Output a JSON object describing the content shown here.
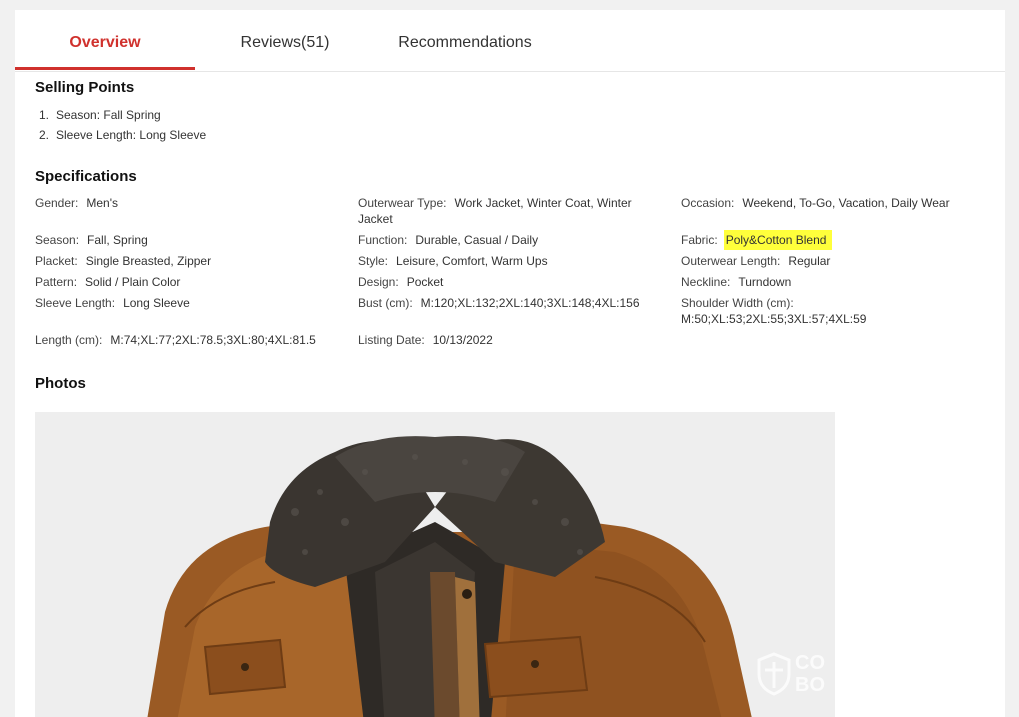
{
  "tabs": [
    {
      "label": "Overview",
      "active": true
    },
    {
      "label": "Reviews(51)",
      "active": false
    },
    {
      "label": "Recommendations",
      "active": false
    }
  ],
  "selling_points": {
    "title": "Selling Points",
    "items": [
      {
        "num": "1.",
        "text": "Season: Fall Spring"
      },
      {
        "num": "2.",
        "text": "Sleeve Length: Long Sleeve"
      }
    ]
  },
  "specifications": {
    "title": "Specifications",
    "items": [
      {
        "key": "Gender:",
        "value": "Men's"
      },
      {
        "key": "Outerwear Type:",
        "value": "Work Jacket, Winter Coat, Winter Jacket"
      },
      {
        "key": "Occasion:",
        "value": "Weekend, To-Go, Vacation, Daily Wear"
      },
      {
        "key": "Season:",
        "value": "Fall, Spring"
      },
      {
        "key": "Function:",
        "value": "Durable, Casual / Daily"
      },
      {
        "key": "Fabric:",
        "value": "Poly&Cotton Blend",
        "highlighted": true
      },
      {
        "key": "Placket:",
        "value": "Single Breasted, Zipper"
      },
      {
        "key": "Style:",
        "value": "Leisure, Comfort, Warm Ups"
      },
      {
        "key": "Outerwear Length:",
        "value": "Regular"
      },
      {
        "key": "Pattern:",
        "value": "Solid / Plain Color"
      },
      {
        "key": "Design:",
        "value": "Pocket"
      },
      {
        "key": "Neckline:",
        "value": "Turndown"
      },
      {
        "key": "Sleeve Length:",
        "value": "Long Sleeve"
      },
      {
        "key": "Bust (cm):",
        "value": "M:120;XL:132;2XL:140;3XL:148;4XL:156"
      },
      {
        "key": "Shoulder Width (cm):",
        "value": "M:50;XL:53;2XL:55;3XL:57;4XL:59"
      },
      {
        "key": "Length (cm):",
        "value": "M:74;XL:77;2XL:78.5;3XL:80;4XL:81.5"
      },
      {
        "key": "Listing Date:",
        "value": "10/13/2022"
      }
    ]
  },
  "photos": {
    "title": "Photos",
    "watermark": "CO BO"
  },
  "colors": {
    "accent": "#d0312d",
    "highlight": "#ffff3b"
  }
}
